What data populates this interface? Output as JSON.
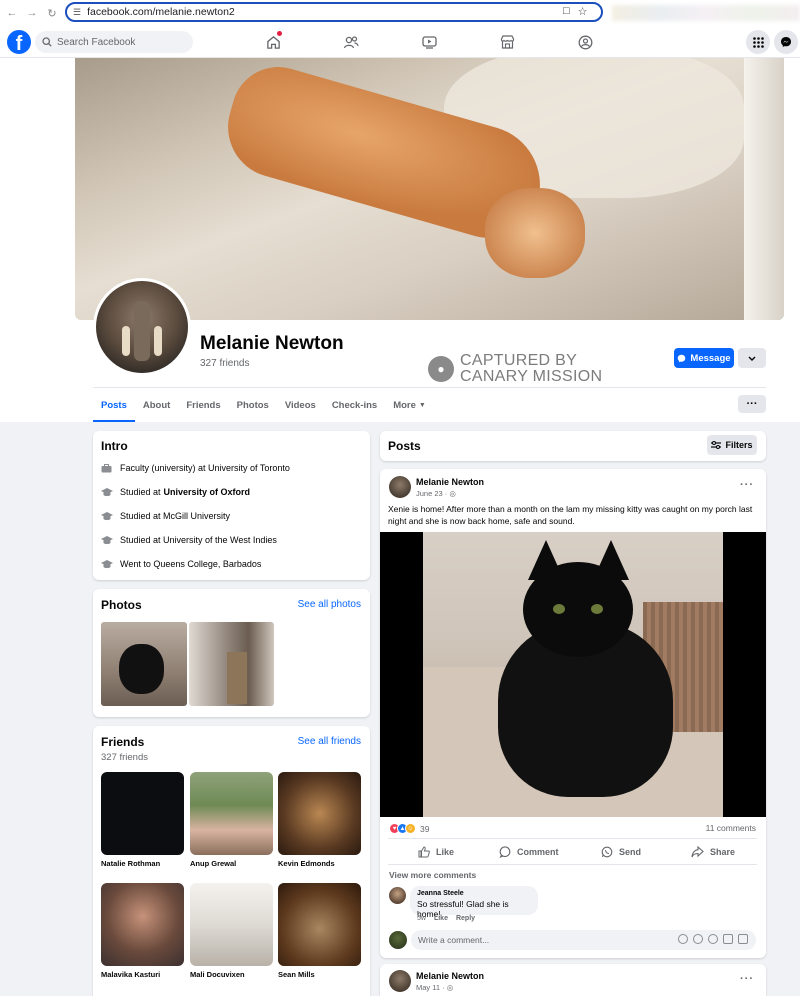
{
  "browser": {
    "url": "facebook.com/melanie.newton2"
  },
  "header": {
    "logo": "f",
    "search_placeholder": "Search Facebook"
  },
  "profile": {
    "name": "Melanie Newton",
    "friends_count": "327 friends",
    "message_label": "Message",
    "watermark_line1": "CAPTURED BY",
    "watermark_line2": "CANARY MISSION"
  },
  "tabs": [
    {
      "label": "Posts"
    },
    {
      "label": "About"
    },
    {
      "label": "Friends"
    },
    {
      "label": "Photos"
    },
    {
      "label": "Videos"
    },
    {
      "label": "Check-ins"
    },
    {
      "label": "More"
    }
  ],
  "intro": {
    "title": "Intro",
    "items": [
      {
        "prefix": "Faculty (university) at University of Toronto",
        "bold": ""
      },
      {
        "prefix": "Studied at",
        "bold": "University of Oxford"
      },
      {
        "prefix": "Studied at McGill University",
        "bold": ""
      },
      {
        "prefix": "Studied at University of the West Indies",
        "bold": ""
      },
      {
        "prefix": "Went to Queens College, Barbados",
        "bold": ""
      }
    ]
  },
  "photos": {
    "title": "Photos",
    "see_all": "See all photos"
  },
  "friends": {
    "title": "Friends",
    "count": "327 friends",
    "see_all": "See all friends",
    "list": [
      {
        "name": "Natalie Rothman"
      },
      {
        "name": "Anup Grewal"
      },
      {
        "name": "Kevin Edmonds"
      },
      {
        "name": "Malavika Kasturi"
      },
      {
        "name": "Mali Docuvixen"
      },
      {
        "name": "Sean Mills"
      }
    ]
  },
  "posts": {
    "title": "Posts",
    "filters_label": "Filters",
    "post1": {
      "author": "Melanie Newton",
      "date": "June 23 ·",
      "text": "Xenie is home! After more than a month on the lam my missing kitty was caught on my porch last night and she is now back home, safe and sound.",
      "reaction_count": "39",
      "comments_count": "11 comments",
      "actions": {
        "like": "Like",
        "comment": "Comment",
        "send": "Send",
        "share": "Share"
      },
      "view_more": "View more comments",
      "comment": {
        "author": "Jeanna Steele",
        "text": "So stressful! Glad she is home!",
        "time": "5w",
        "like": "Like",
        "reply": "Reply"
      },
      "write_placeholder": "Write a comment..."
    },
    "post2": {
      "author": "Melanie Newton",
      "date": "May 11 ·"
    }
  }
}
